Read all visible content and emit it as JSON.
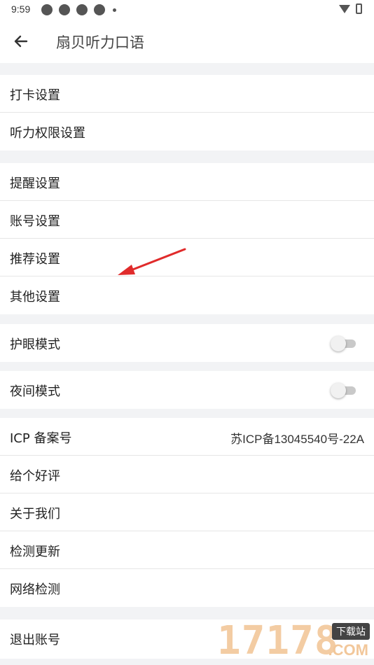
{
  "status_bar": {
    "time": "9:59"
  },
  "header": {
    "title": "扇贝听力口语"
  },
  "groups": {
    "group1": [
      "打卡设置",
      "听力权限设置"
    ],
    "group2": [
      "提醒设置",
      "账号设置",
      "推荐设置",
      "其他设置"
    ],
    "eye_mode": {
      "label": "护眼模式",
      "enabled": false
    },
    "night_mode": {
      "label": "夜间模式",
      "enabled": false
    },
    "group5": {
      "icp_label": "ICP 备案号",
      "icp_value": "苏ICP备13045540号-22A",
      "items": [
        "给个好评",
        "关于我们",
        "检测更新",
        "网络检测"
      ]
    },
    "logout": "退出账号"
  },
  "watermark": {
    "digits": "17178",
    "tag": "下载站",
    "suffix": ".COM"
  },
  "colors": {
    "annotation_arrow": "#e02b2b",
    "toggle_track": "#c9c9c9"
  }
}
